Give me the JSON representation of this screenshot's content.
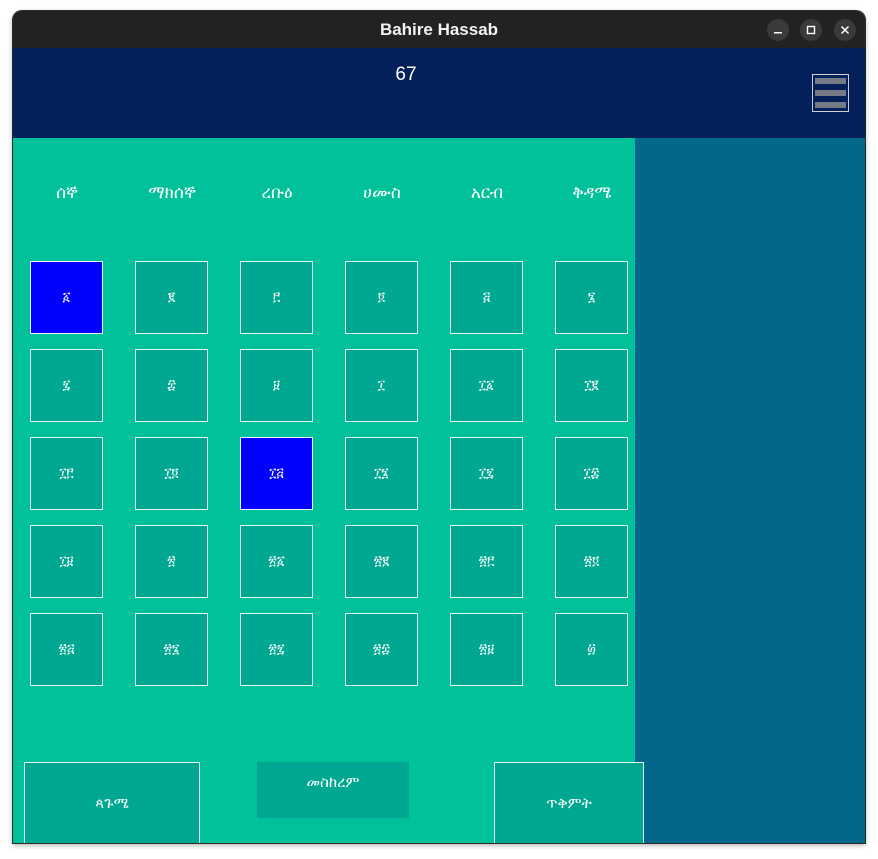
{
  "window": {
    "title": "Bahire Hassab"
  },
  "header": {
    "year": "67"
  },
  "days": [
    "ሰኞ",
    "ማክሰኞ",
    "ረቡዕ",
    "ሀሙስ",
    "አርብ",
    "ቅዳሜ"
  ],
  "calendar": {
    "cells": [
      "፩",
      "፪",
      "፫",
      "፬",
      "፭",
      "፮",
      "፯",
      "፰",
      "፱",
      "፲",
      "፲፩",
      "፲፪",
      "፲፫",
      "፲፬",
      "፲፭",
      "፲፮",
      "፲፯",
      "፲፰",
      "፲፱",
      "፳",
      "፳፩",
      "፳፪",
      "፳፫",
      "፳፬",
      "፳፭",
      "፳፮",
      "፳፯",
      "፳፰",
      "፳፱",
      "፴"
    ],
    "selected": [
      "፩",
      "፲፭"
    ]
  },
  "buttons": {
    "pagume": "ጳጉሜ",
    "meskerem": "መስከረም",
    "tikimt": "ጥቅምት"
  },
  "colors": {
    "header_bg": "#03205b",
    "grid_bg": "#00c19a",
    "cell_bg": "#00a892",
    "selected_bg": "#0000ff",
    "side_panel": "#03668b"
  },
  "icons": {
    "minimize": "minimize-icon",
    "maximize": "maximize-icon",
    "close": "close-icon",
    "menu": "hamburger-menu-icon"
  }
}
